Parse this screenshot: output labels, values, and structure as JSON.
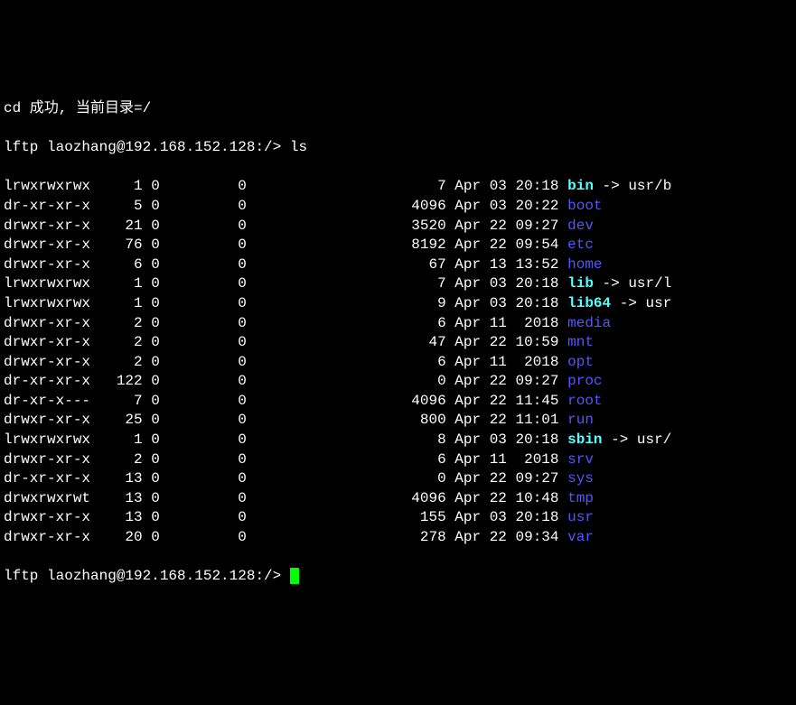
{
  "header_line": "cd 成功, 当前目录=/",
  "prompt": "lftp laozhang@192.168.152.128:/>",
  "command": "ls",
  "prompt2": "lftp laozhang@192.168.152.128:/>",
  "listing": [
    {
      "perms": "lrwxrwxrwx",
      "links": "1",
      "owner": "0",
      "group": "0",
      "size": "7",
      "month": "Apr",
      "day": "03",
      "time": "20:18",
      "name": "bin",
      "color": "cyan",
      "target": "usr/b"
    },
    {
      "perms": "dr-xr-xr-x",
      "links": "5",
      "owner": "0",
      "group": "0",
      "size": "4096",
      "month": "Apr",
      "day": "03",
      "time": "20:22",
      "name": "boot",
      "color": "blue"
    },
    {
      "perms": "drwxr-xr-x",
      "links": "21",
      "owner": "0",
      "group": "0",
      "size": "3520",
      "month": "Apr",
      "day": "22",
      "time": "09:27",
      "name": "dev",
      "color": "blue"
    },
    {
      "perms": "drwxr-xr-x",
      "links": "76",
      "owner": "0",
      "group": "0",
      "size": "8192",
      "month": "Apr",
      "day": "22",
      "time": "09:54",
      "name": "etc",
      "color": "blue"
    },
    {
      "perms": "drwxr-xr-x",
      "links": "6",
      "owner": "0",
      "group": "0",
      "size": "67",
      "month": "Apr",
      "day": "13",
      "time": "13:52",
      "name": "home",
      "color": "blue"
    },
    {
      "perms": "lrwxrwxrwx",
      "links": "1",
      "owner": "0",
      "group": "0",
      "size": "7",
      "month": "Apr",
      "day": "03",
      "time": "20:18",
      "name": "lib",
      "color": "cyan",
      "target": "usr/l"
    },
    {
      "perms": "lrwxrwxrwx",
      "links": "1",
      "owner": "0",
      "group": "0",
      "size": "9",
      "month": "Apr",
      "day": "03",
      "time": "20:18",
      "name": "lib64",
      "color": "cyan",
      "target": "usr"
    },
    {
      "perms": "drwxr-xr-x",
      "links": "2",
      "owner": "0",
      "group": "0",
      "size": "6",
      "month": "Apr",
      "day": "11",
      "time": " 2018",
      "name": "media",
      "color": "blue"
    },
    {
      "perms": "drwxr-xr-x",
      "links": "2",
      "owner": "0",
      "group": "0",
      "size": "47",
      "month": "Apr",
      "day": "22",
      "time": "10:59",
      "name": "mnt",
      "color": "blue"
    },
    {
      "perms": "drwxr-xr-x",
      "links": "2",
      "owner": "0",
      "group": "0",
      "size": "6",
      "month": "Apr",
      "day": "11",
      "time": " 2018",
      "name": "opt",
      "color": "blue"
    },
    {
      "perms": "dr-xr-xr-x",
      "links": "122",
      "owner": "0",
      "group": "0",
      "size": "0",
      "month": "Apr",
      "day": "22",
      "time": "09:27",
      "name": "proc",
      "color": "blue"
    },
    {
      "perms": "dr-xr-x---",
      "links": "7",
      "owner": "0",
      "group": "0",
      "size": "4096",
      "month": "Apr",
      "day": "22",
      "time": "11:45",
      "name": "root",
      "color": "blue"
    },
    {
      "perms": "drwxr-xr-x",
      "links": "25",
      "owner": "0",
      "group": "0",
      "size": "800",
      "month": "Apr",
      "day": "22",
      "time": "11:01",
      "name": "run",
      "color": "blue"
    },
    {
      "perms": "lrwxrwxrwx",
      "links": "1",
      "owner": "0",
      "group": "0",
      "size": "8",
      "month": "Apr",
      "day": "03",
      "time": "20:18",
      "name": "sbin",
      "color": "cyan",
      "target": "usr/"
    },
    {
      "perms": "drwxr-xr-x",
      "links": "2",
      "owner": "0",
      "group": "0",
      "size": "6",
      "month": "Apr",
      "day": "11",
      "time": " 2018",
      "name": "srv",
      "color": "blue"
    },
    {
      "perms": "dr-xr-xr-x",
      "links": "13",
      "owner": "0",
      "group": "0",
      "size": "0",
      "month": "Apr",
      "day": "22",
      "time": "09:27",
      "name": "sys",
      "color": "blue"
    },
    {
      "perms": "drwxrwxrwt",
      "links": "13",
      "owner": "0",
      "group": "0",
      "size": "4096",
      "month": "Apr",
      "day": "22",
      "time": "10:48",
      "name": "tmp",
      "color": "blue"
    },
    {
      "perms": "drwxr-xr-x",
      "links": "13",
      "owner": "0",
      "group": "0",
      "size": "155",
      "month": "Apr",
      "day": "03",
      "time": "20:18",
      "name": "usr",
      "color": "blue"
    },
    {
      "perms": "drwxr-xr-x",
      "links": "20",
      "owner": "0",
      "group": "0",
      "size": "278",
      "month": "Apr",
      "day": "22",
      "time": "09:34",
      "name": "var",
      "color": "blue"
    }
  ]
}
